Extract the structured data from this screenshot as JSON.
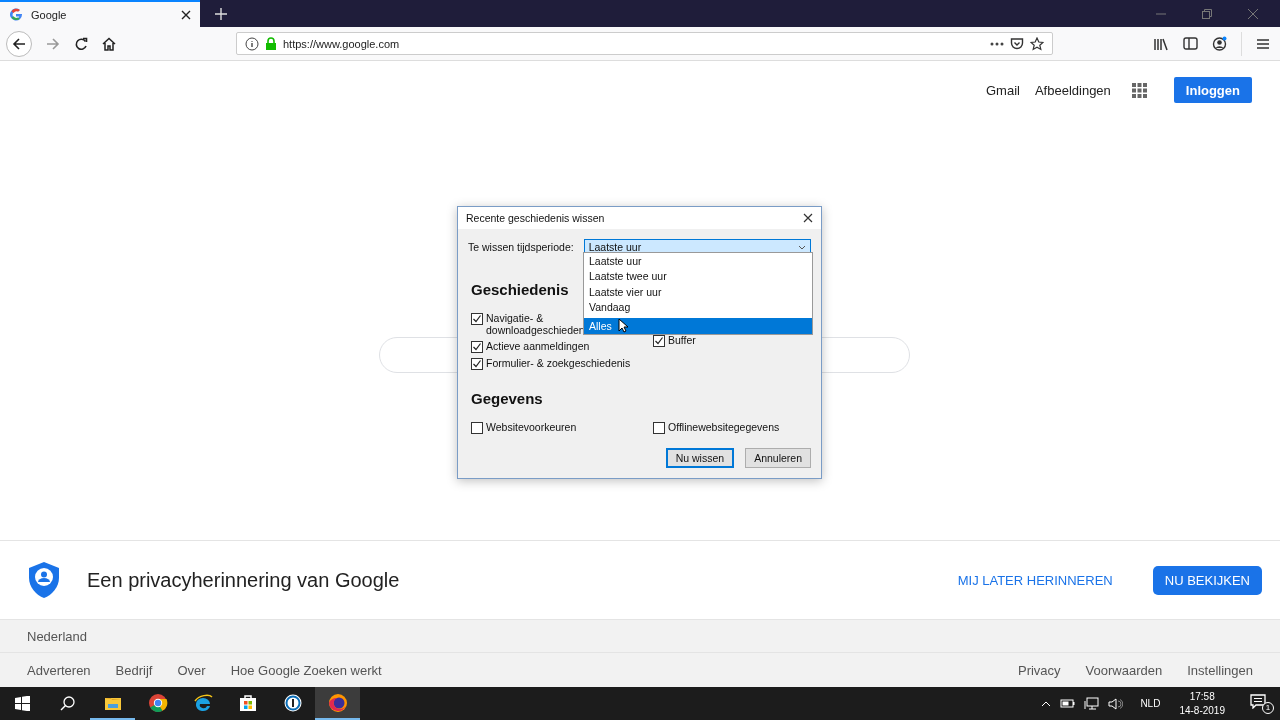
{
  "browser": {
    "tabs": [
      {
        "title": "Google",
        "selected": true
      }
    ],
    "url": "https://www.google.com"
  },
  "header": {
    "links": [
      "Gmail",
      "Afbeeldingen"
    ],
    "sign_in": "Inloggen"
  },
  "dialog": {
    "title": "Recente geschiedenis wissen",
    "period_label": "Te wissen tijdsperiode:",
    "period_value": "Laatste uur",
    "options": [
      {
        "label": "Laatste uur",
        "selected": false
      },
      {
        "label": "Laatste twee uur",
        "selected": false
      },
      {
        "label": "Laatste vier uur",
        "selected": false
      },
      {
        "label": "Vandaag",
        "selected": false
      },
      {
        "label": "Alles",
        "selected": true
      }
    ],
    "sections": [
      {
        "heading": "Geschiedenis",
        "columns": [
          [
            {
              "label": "Navigatie- & downloadgeschieden",
              "checked": true
            },
            {
              "label": "Actieve aanmeldingen",
              "checked": true
            },
            {
              "label": "Formulier- & zoekgeschiedenis",
              "checked": true
            }
          ],
          [
            {
              "label": "Buffer",
              "checked": true
            }
          ]
        ]
      },
      {
        "heading": "Gegevens",
        "columns": [
          [
            {
              "label": "Websitevoorkeuren",
              "checked": false
            }
          ],
          [
            {
              "label": "Offlinewebsitegegevens",
              "checked": false
            }
          ]
        ]
      }
    ],
    "buttons": [
      {
        "label": "Nu wissen",
        "default": true
      },
      {
        "label": "Annuleren",
        "default": false
      }
    ]
  },
  "privacy_banner": {
    "title": "Een privacyherinnering van Google",
    "remind_later": "MIJ LATER HERINNEREN",
    "view_now": "NU BEKIJKEN"
  },
  "footer": {
    "country": "Nederland",
    "left_links": [
      "Adverteren",
      "Bedrijf",
      "Over",
      "Hoe Google Zoeken werkt"
    ],
    "right_links": [
      "Privacy",
      "Voorwaarden",
      "Instellingen"
    ]
  },
  "taskbar": {
    "apps": [
      {
        "kind": "explorer",
        "running": true,
        "selected": false
      },
      {
        "kind": "chrome",
        "running": false,
        "selected": false
      },
      {
        "kind": "edge",
        "running": false,
        "selected": false
      },
      {
        "kind": "store",
        "running": false,
        "selected": false
      },
      {
        "kind": "keys",
        "running": false,
        "selected": false
      },
      {
        "kind": "firefox",
        "running": true,
        "selected": true
      }
    ],
    "language": "NLD",
    "time": "17:58",
    "date": "14-8-2019",
    "notifications": "1"
  }
}
